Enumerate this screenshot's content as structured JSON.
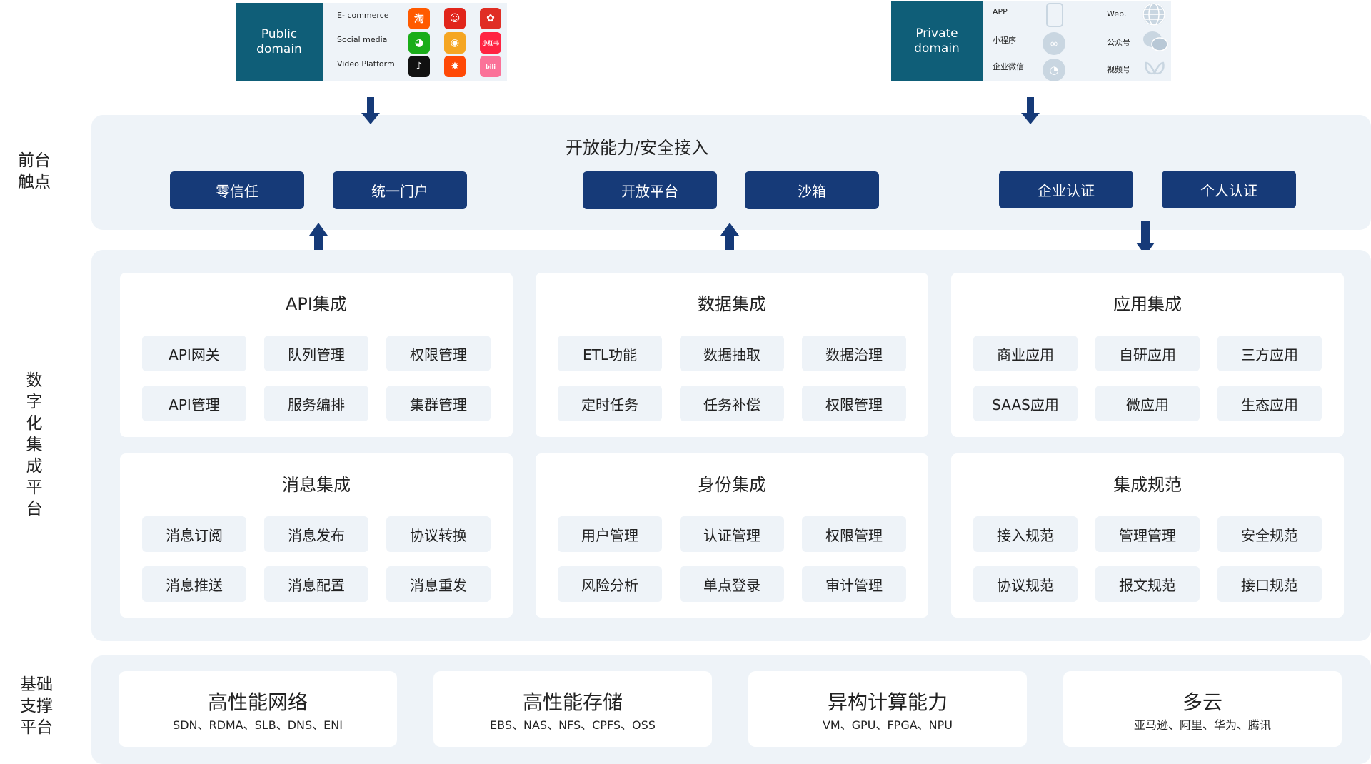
{
  "public_channel": {
    "title_line1": "Public",
    "title_line2": "domain",
    "rows": [
      "E- commerce",
      "Social media",
      "Video Platform"
    ],
    "icons": [
      {
        "name": "taobao-icon",
        "glyph": "淘",
        "color": "#ff5a00"
      },
      {
        "name": "jd-icon",
        "glyph": "☺",
        "color": "#e1251b"
      },
      {
        "name": "pinduoduo-icon",
        "glyph": "✿",
        "color": "#e02e24"
      },
      {
        "name": "wechat-icon",
        "glyph": "◕",
        "color": "#1aad19"
      },
      {
        "name": "weibo-icon",
        "glyph": "◉",
        "color": "#f5a623"
      },
      {
        "name": "xiaohongshu-icon",
        "glyph": "小红书",
        "color": "#ff2442"
      },
      {
        "name": "douyin-icon",
        "glyph": "♪",
        "color": "#111111"
      },
      {
        "name": "kuaishou-icon",
        "glyph": "✸",
        "color": "#ff4906"
      },
      {
        "name": "bilibili-icon",
        "glyph": "bili",
        "color": "#fb7299"
      }
    ]
  },
  "private_channel": {
    "title_line1": "Private",
    "title_line2": "domain",
    "left_labels": [
      "APP",
      "小程序",
      "企业微信"
    ],
    "right_labels": [
      "Web.",
      "公众号",
      "视频号"
    ],
    "left_icons": [
      "phone-icon",
      "miniprogram-icon",
      "wecom-icon"
    ],
    "right_icons": [
      "globe-icon",
      "official-account-icon",
      "channels-icon"
    ]
  },
  "side_labels": {
    "front": [
      "前台",
      "触点"
    ],
    "platform": [
      "数",
      "字",
      "化",
      "集",
      "成",
      "平",
      "台"
    ],
    "base": [
      "基础",
      "支撑",
      "平台"
    ]
  },
  "front": {
    "title": "开放能力/安全接入",
    "buttons": [
      "零信任",
      "统一门户",
      "开放平台",
      "沙箱",
      "企业认证",
      "个人认证"
    ]
  },
  "modules": [
    {
      "title": "API集成",
      "items": [
        "API网关",
        "队列管理",
        "权限管理",
        "API管理",
        "服务编排",
        "集群管理"
      ]
    },
    {
      "title": "数据集成",
      "items": [
        "ETL功能",
        "数据抽取",
        "数据治理",
        "定时任务",
        "任务补偿",
        "权限管理"
      ]
    },
    {
      "title": "应用集成",
      "items": [
        "商业应用",
        "自研应用",
        "三方应用",
        "SAAS应用",
        "微应用",
        "生态应用"
      ]
    },
    {
      "title": "消息集成",
      "items": [
        "消息订阅",
        "消息发布",
        "协议转换",
        "消息推送",
        "消息配置",
        "消息重发"
      ]
    },
    {
      "title": "身份集成",
      "items": [
        "用户管理",
        "认证管理",
        "权限管理",
        "风险分析",
        "单点登录",
        "审计管理"
      ]
    },
    {
      "title": "集成规范",
      "items": [
        "接入规范",
        "管理管理",
        "安全规范",
        "协议规范",
        "报文规范",
        "接口规范"
      ]
    }
  ],
  "base": [
    {
      "title": "高性能网络",
      "sub": "SDN、RDMA、SLB、DNS、ENI"
    },
    {
      "title": "高性能存储",
      "sub": "EBS、NAS、NFS、CPFS、OSS"
    },
    {
      "title": "异构计算能力",
      "sub": "VM、GPU、FPGA、NPU"
    },
    {
      "title": "多云",
      "sub": "亚马逊、阿里、华为、腾讯"
    }
  ],
  "colors": {
    "brand_dark": "#163a78",
    "teal": "#0f5e78",
    "panel": "#eef3f8"
  }
}
